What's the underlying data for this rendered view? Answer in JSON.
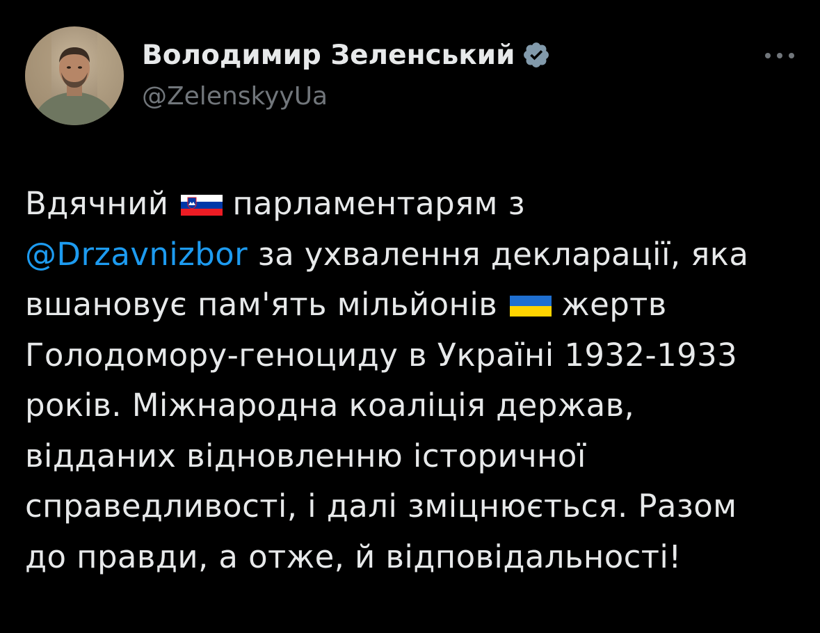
{
  "author": {
    "display_name": "Володимир Зеленський",
    "handle": "@ZelenskyyUa",
    "verified_color": "#829aab"
  },
  "more_icon": "more-horizontal-icon",
  "tweet": {
    "line1_before_flag": "Вдячний",
    "flag1": "slovenia-flag",
    "line1_after_flag": "парламентарям з",
    "mention": "@Drzavnizbor",
    "line2_after_mention": " за ухвалення декларації, яка",
    "line3_before_flag": "вшановує пам'ять мільйонів",
    "flag2": "ukraine-flag",
    "line3_after_flag": "жертв",
    "line4": "Голодомору-геноциду в Україні 1932-1933",
    "line5": "років. Міжнародна коаліція держав,",
    "line6": "відданих відновленню історичної",
    "line7": "справедливості, і далі зміцнюється. Разом",
    "line8": "до правди, а отже, й відповідальності!"
  },
  "colors": {
    "background": "#000000",
    "text": "#e7e9ea",
    "secondary": "#71767b",
    "link": "#1d9bf0"
  }
}
